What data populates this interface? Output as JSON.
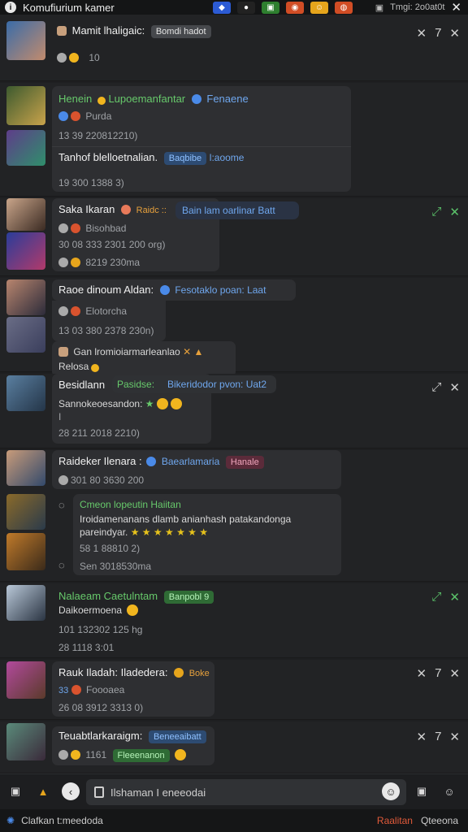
{
  "app": {
    "title": "Komufiurium kamer",
    "right_label": "Tmgi: 2o0at0t"
  },
  "posts": [
    {
      "name": "Mamit lhaligaic:",
      "chip": "Bomdi hadot",
      "sub": "10",
      "actions": [
        "✕",
        "7",
        "✕"
      ]
    },
    {
      "line1a": "Henein",
      "line1b": "Lupoemanfantar",
      "line1c": "Fenaene",
      "line2": "Purda",
      "time1": "13 39 220812210)",
      "line3": "Tanhof blelloetnalian.",
      "chip": "Baqbibe",
      "chip2": "l:aoome",
      "time2": "19 300 1388 3)"
    },
    {
      "name": "Saka Ikaran",
      "tag": "Raidc ::",
      "chip": "Bain lam oarlinar Batt",
      "line2": "Bisohbad",
      "time1": "30 08 333 2301 200 org)",
      "time2": "8219 230ma"
    },
    {
      "name": "Raoe dinoum Aldan:",
      "chip": "Fesotaklo poan: Laat",
      "line2": "Elotorcha",
      "time1": "13 03 380 2378 230n)",
      "line3": "Gan lromioiarmarleanlao",
      "line4": "Relosa"
    },
    {
      "name": "Besidlann",
      "chip": "Bikeridodor pvon: Uat2",
      "tag": "Pasidse:",
      "line2": "Sannokeoesandon:",
      "line3": "I",
      "time1": "28 211 2018 2210)"
    },
    {
      "name": "Raideker Ilenara :",
      "tag": "Baearlamaria",
      "chip": "Hanale",
      "time1": "301 80 3630 200",
      "line2": "Cmeon lopeutin Haiitan",
      "line3": "Iroidamenanans dlamb anianhash patakandonga",
      "line4": "pareindyar.",
      "time2": "58 1 88810 2)",
      "time3": "Sen 3018530ma"
    },
    {
      "name": "Nalaeam Caetulntam",
      "chip": "Banpobl 9",
      "line2": "Daikoermoena",
      "time1": "101 132302 125 hg",
      "time2": "28 1118 3:01"
    },
    {
      "name": "Rauk Iladah: Iladedera:",
      "tag": "Boke",
      "line2": "Foooaea",
      "time1": "26 08 3912 3313 0)"
    },
    {
      "name": "Teuabtlarkaraigm:",
      "chip": "Beneeaibatt",
      "chip2": "Fleeenanon",
      "sub": "1161"
    }
  ],
  "composer": {
    "placeholder": "Ilshaman I eneeodai"
  },
  "footer": {
    "left": "Clafkan t:meedoda",
    "right1": "Raalitan",
    "right2": "Qteeona"
  }
}
